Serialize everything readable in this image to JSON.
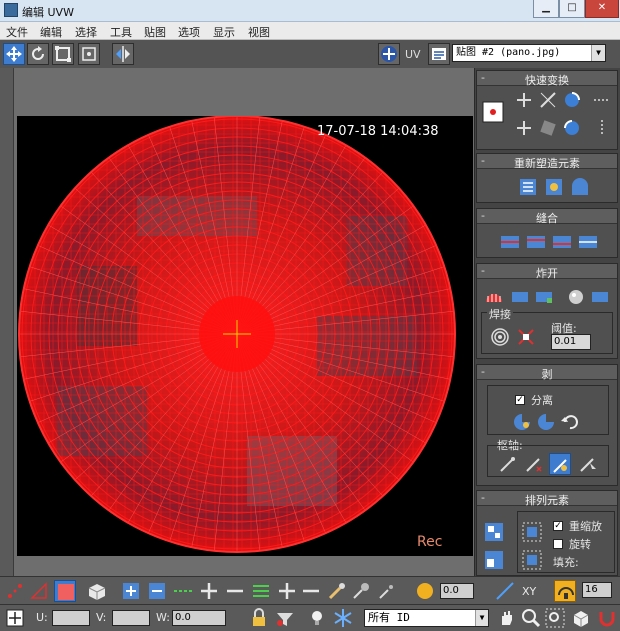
{
  "window": {
    "title": "编辑 UVW",
    "min_label": "▁",
    "max_label": "□",
    "close_label": "✕"
  },
  "menu": [
    "文件",
    "编辑",
    "选择",
    "工具",
    "贴图",
    "选项",
    "显示",
    "视图"
  ],
  "top_toolbar": {
    "uv_label": "UV",
    "map_select": "贴图 #2 (pano.jpg)"
  },
  "viewport": {
    "timestamp": "17-07-18 14:04:38",
    "rec_label": "Rec",
    "accent": "#ff1a1a"
  },
  "panel": {
    "quick_transform": "快速变换",
    "reshape_elements": "重新塑造元素",
    "stitch": "缝合",
    "explode": "炸开",
    "weld": "焊接",
    "threshold_label": "阈值:",
    "threshold_value": "0.01",
    "peel": "剥",
    "detach_label": "分离",
    "pivot_label": "枢轴:",
    "arrange_elements": "排列元素",
    "rescale_label": "重缩放",
    "rotate_label": "旋转",
    "padding_label": "填充:"
  },
  "bottom": {
    "spin_value": "0.0",
    "xy_label": "XY",
    "zoom_value": "16",
    "u_label": "U:",
    "v_label": "V:",
    "w_label": "W:",
    "w_value": "0.0",
    "id_select": "所有 ID"
  }
}
